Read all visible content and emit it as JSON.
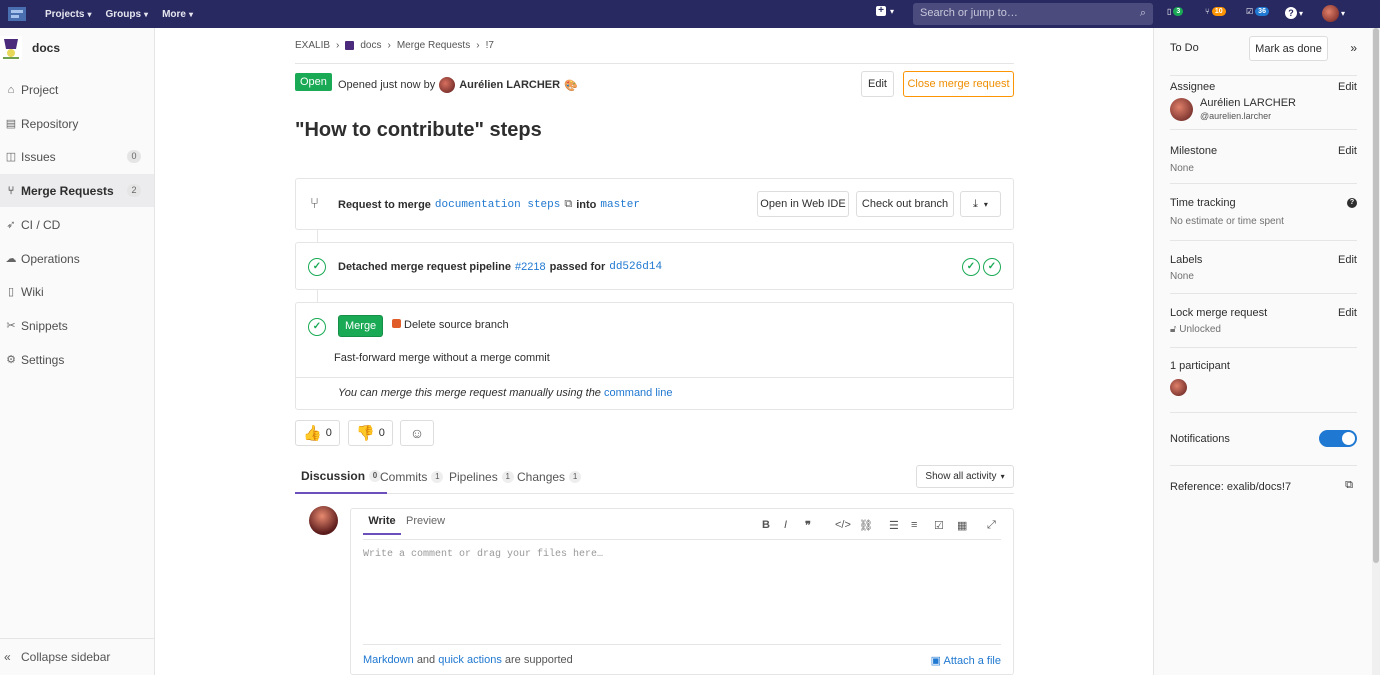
{
  "topbar": {
    "nav": [
      {
        "label": "Projects"
      },
      {
        "label": "Groups"
      },
      {
        "label": "More"
      }
    ],
    "search_placeholder": "Search or jump to…",
    "counts": {
      "issues": "3",
      "mrs": "10",
      "todos": "36"
    }
  },
  "sidebar": {
    "project": "docs",
    "items": [
      {
        "label": "Project",
        "count": ""
      },
      {
        "label": "Repository",
        "count": ""
      },
      {
        "label": "Issues",
        "count": "0"
      },
      {
        "label": "Merge Requests",
        "count": "2"
      },
      {
        "label": "CI / CD",
        "count": ""
      },
      {
        "label": "Operations",
        "count": ""
      },
      {
        "label": "Wiki",
        "count": ""
      },
      {
        "label": "Snippets",
        "count": ""
      },
      {
        "label": "Settings",
        "count": ""
      }
    ],
    "collapse": "Collapse sidebar"
  },
  "breadcrumb": [
    "EXALIB",
    "docs",
    "Merge Requests",
    "!7"
  ],
  "mr": {
    "status": "Open",
    "opened": "Opened just now by",
    "author": "Aurélien LARCHER",
    "edit": "Edit",
    "close": "Close merge request",
    "title": "\"How to contribute\" steps",
    "request_to_merge": "Request to merge",
    "source_branch": "documentation steps",
    "into": "into",
    "target_branch": "master",
    "open_web_ide": "Open in Web IDE",
    "checkout": "Check out branch",
    "pipeline_text": "Detached merge request pipeline",
    "pipeline_id": "#2218",
    "passed_for": "passed for",
    "commit": "dd526d14",
    "merge": "Merge",
    "delete_source": "Delete source branch",
    "ff_note": "Fast-forward merge without a merge commit",
    "manual_note": "You can merge this merge request manually using the",
    "command_line": "command line",
    "thumbs_up": "0",
    "thumbs_down": "0"
  },
  "tabs": [
    {
      "label": "Discussion",
      "count": "0"
    },
    {
      "label": "Commits",
      "count": "1"
    },
    {
      "label": "Pipelines",
      "count": "1"
    },
    {
      "label": "Changes",
      "count": "1"
    }
  ],
  "show_activity": "Show all activity",
  "editor": {
    "write": "Write",
    "preview": "Preview",
    "placeholder": "Write a comment or drag your files here…",
    "markdown": "Markdown",
    "and": "and",
    "quick_actions": "quick actions",
    "supported": "are supported",
    "attach": "Attach a file"
  },
  "right": {
    "todo": "To Do",
    "mark_done": "Mark as done",
    "assignee": "Assignee",
    "edit": "Edit",
    "assignee_name": "Aurélien LARCHER",
    "assignee_handle": "@aurelien.larcher",
    "milestone": "Milestone",
    "milestone_val": "None",
    "time": "Time tracking",
    "time_val": "No estimate or time spent",
    "labels": "Labels",
    "labels_val": "None",
    "lock": "Lock merge request",
    "lock_val": "Unlocked",
    "participants": "1 participant",
    "notifications": "Notifications",
    "reference": "Reference: exalib/docs!7"
  }
}
